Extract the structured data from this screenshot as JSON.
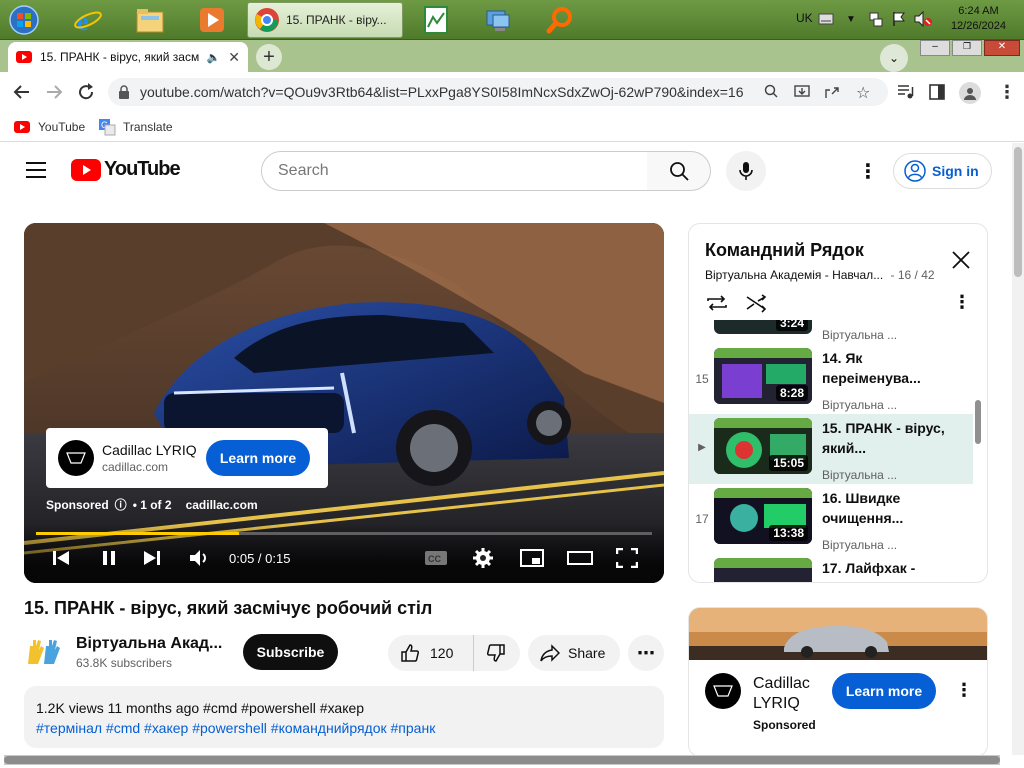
{
  "taskbar": {
    "active_window": "15. ПРАНК - віру...",
    "lang": "UK",
    "time": "6:24 AM",
    "date": "12/26/2024"
  },
  "browser": {
    "tab_title": "15. ПРАНК - вірус, який засм",
    "url": "youtube.com/watch?v=QOu9v3Rtb64&list=PLxxPga8YS0I58ImNcxSdxZwOj-62wP790&index=16",
    "bookmarks": [
      "YouTube",
      "Translate"
    ]
  },
  "youtube": {
    "logo": "YouTube",
    "search_placeholder": "Search",
    "sign_in": "Sign in"
  },
  "player": {
    "ad_brand": "Cadillac LYRIQ",
    "ad_site": "cadillac.com",
    "ad_cta": "Learn more",
    "sponsored": "Sponsored",
    "ad_count": "• 1 of 2",
    "ad_domain": "cadillac.com",
    "time": "0:05 / 0:15",
    "progress": 0.33
  },
  "video": {
    "title": "15. ПРАНК - вірус, який засмічує робочий стіл",
    "channel": "Віртуальна Акад...",
    "subscribers": "63.8K subscribers",
    "subscribe": "Subscribe",
    "likes": "120",
    "share": "Share",
    "desc_line1": "1.2K views  11 months ago  #cmd #powershell #хакер",
    "desc_line2": "#термінал #cmd #хакер #powershell  #команднийрядок #пранк"
  },
  "playlist": {
    "title": "Командний Рядок",
    "subtitle": "Віртуальна Академія - Навчал...",
    "position": "- 16 / 42",
    "items": [
      {
        "index": "",
        "duration": "3:24",
        "title": "",
        "channel": "Віртуальна ..."
      },
      {
        "index": "15",
        "duration": "8:28",
        "title": "14. Як переіменува...",
        "channel": "Віртуальна ..."
      },
      {
        "index": "▶",
        "duration": "15:05",
        "title": "15. ПРАНК - вірус, який...",
        "channel": "Віртуальна ..."
      },
      {
        "index": "17",
        "duration": "13:38",
        "title": "16. Швидке очищення...",
        "channel": "Віртуальна ..."
      },
      {
        "index": "",
        "duration": "",
        "title": "17. Лайфхак -",
        "channel": ""
      }
    ]
  },
  "side_ad": {
    "brand": "Cadillac LYRIQ",
    "sponsored": "Sponsored",
    "cta": "Learn more"
  },
  "colors": {
    "accent": "#065fd4",
    "youtube_red": "#ff0000",
    "progress": "#ffcc00",
    "highlight": "#e1f0ec"
  }
}
